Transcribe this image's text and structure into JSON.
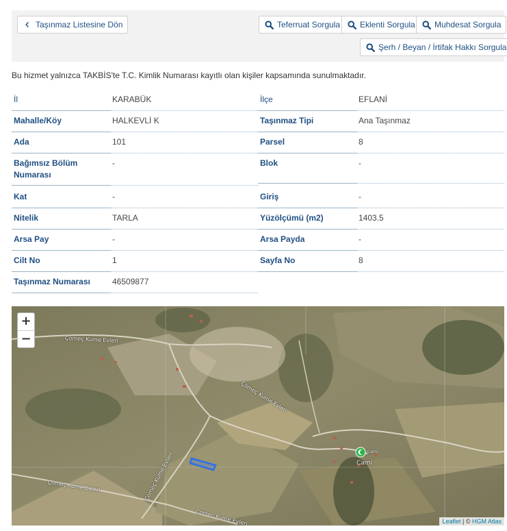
{
  "toolbar": {
    "back_label": "Taşınmaz Listesine Dön",
    "teferruat_label": "Teferruat Sorgula",
    "eklenti_label": "Eklenti Sorgula",
    "muhdesat_label": "Muhdesat Sorgula",
    "serh_label": "Şerh / Beyan / İrtifak Hakkı Sorgula"
  },
  "notice": "Bu hizmet yalnızca TAKBİS'te T.C. Kimlik Numarası kayıtlı olan kişiler kapsamında sunulmaktadır.",
  "details": {
    "il_label": "İl",
    "il_value": "KARABÜK",
    "ilce_label": "İlçe",
    "ilce_value": "EFLANİ",
    "mahalle_label": "Mahalle/Köy",
    "mahalle_value": "HALKEVLİ K",
    "tip_label": "Taşınmaz Tipi",
    "tip_value": "Ana Taşınmaz",
    "ada_label": "Ada",
    "ada_value": "101",
    "parsel_label": "Parsel",
    "parsel_value": "8",
    "bagimsiz_label": "Bağımsız Bölüm Numarası",
    "bagimsiz_value": "-",
    "blok_label": "Blok",
    "blok_value": "-",
    "kat_label": "Kat",
    "kat_value": "-",
    "giris_label": "Giriş",
    "giris_value": "-",
    "nitelik_label": "Nitelik",
    "nitelik_value": "TARLA",
    "yuzolcumu_label": "Yüzölçümü (m2)",
    "yuzolcumu_value": "1403.5",
    "arsapay_label": "Arsa Pay",
    "arsapay_value": "-",
    "arsapayda_label": "Arsa Payda",
    "arsapayda_value": "-",
    "cilt_label": "Cilt No",
    "cilt_value": "1",
    "sayfa_label": "Sayfa No",
    "sayfa_value": "8",
    "numara_label": "Taşınmaz Numarası",
    "numara_value": "46509877"
  },
  "map": {
    "zoom_in": "+",
    "zoom_out": "−",
    "attribution_leaflet": "Leaflet",
    "attribution_sep": " | © ",
    "attribution_hgm": "HGM Atlas",
    "label_1": "Çomeç Kume Evleri",
    "label_2": "Çomeç Kume Evleri",
    "label_3": "Çomeç Kume Evleri",
    "label_4": "Çomeç Kume Evleri",
    "label_5": "Çomeç Kume Evleri",
    "label_cami": "Cami",
    "label_poi": "Cami"
  },
  "colors": {
    "accent": "#1f4f82",
    "toolbar_bg": "#f2f2f2",
    "parcel": "#2d6fe8",
    "mosque_marker": "#2db34a"
  }
}
